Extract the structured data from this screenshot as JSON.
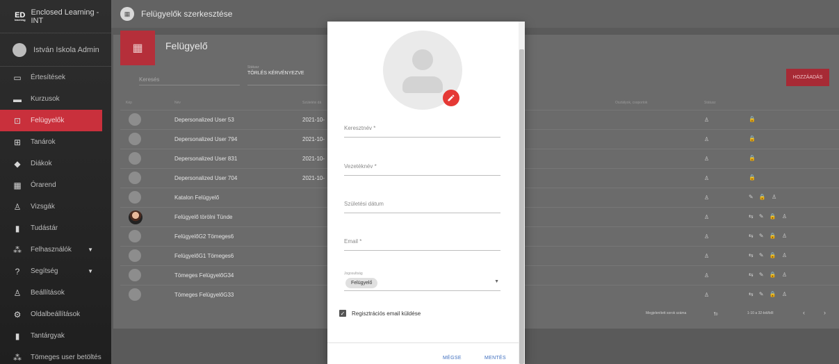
{
  "app": {
    "brand": "Enclosed Learning - INT",
    "logo": "ED",
    "logo_sub": "learning"
  },
  "user": {
    "name": "István Iskola Admin"
  },
  "sidebar": {
    "items": [
      {
        "label": "Értesítések",
        "icon": "message-icon",
        "glyph": "▭"
      },
      {
        "label": "Kurzusok",
        "icon": "course-icon",
        "glyph": "▬"
      },
      {
        "label": "Felügyelők",
        "icon": "monitor-person-icon",
        "glyph": "⊡",
        "active": true
      },
      {
        "label": "Tanárok",
        "icon": "teacher-icon",
        "glyph": "⊞"
      },
      {
        "label": "Diákok",
        "icon": "school-icon",
        "glyph": "◆"
      },
      {
        "label": "Órarend",
        "icon": "calendar-icon",
        "glyph": "▦"
      },
      {
        "label": "Vizsgák",
        "icon": "exam-icon",
        "glyph": "♙"
      },
      {
        "label": "Tudástár",
        "icon": "library-icon",
        "glyph": "▮"
      },
      {
        "label": "Felhasználók",
        "icon": "users-icon",
        "glyph": "⁂",
        "chevron": true
      },
      {
        "label": "Segítség",
        "icon": "help-icon",
        "glyph": "?",
        "chevron": true
      },
      {
        "label": "Beállítások",
        "icon": "settings-person-icon",
        "glyph": "♙"
      },
      {
        "label": "Oldalbeállítások",
        "icon": "site-settings-icon",
        "glyph": "⚙"
      },
      {
        "label": "Tantárgyak",
        "icon": "subjects-icon",
        "glyph": "▮"
      },
      {
        "label": "Tömeges user betöltés",
        "icon": "bulk-upload-icon",
        "glyph": "⁂"
      }
    ]
  },
  "topbar": {
    "title": "Felügyelők szerkesztése"
  },
  "page": {
    "title": "Felügyelő",
    "search_placeholder": "Keresés",
    "status_label": "Státusz",
    "status_value": "TÖRLÉS KÉRVÉNYEZVE",
    "add_button": "HOZZÁADÁS",
    "columns": [
      "Kép",
      "Név",
      "Születési dá",
      "Osztályok, csoportok",
      "Státusz"
    ],
    "rows": [
      {
        "name": "Depersonalized User 53",
        "dob": "2021-10-",
        "status": "♙",
        "actions": "🔒"
      },
      {
        "name": "Depersonalized User 794",
        "dob": "2021-10-",
        "status": "♙",
        "actions": "🔒"
      },
      {
        "name": "Depersonalized User 831",
        "dob": "2021-10-",
        "status": "♙",
        "actions": "🔒"
      },
      {
        "name": "Depersonalized User 704",
        "dob": "2021-10-",
        "status": "♙",
        "actions": "🔒"
      },
      {
        "name": "Katalon Felügyelő",
        "dob": "",
        "status": "♙",
        "actions": "✎ 🔒 ♙"
      },
      {
        "name": "Felügyelő törölni Tünde",
        "dob": "",
        "status": "♙",
        "actions": "⇆ ✎ 🔒 ♙",
        "photo": true
      },
      {
        "name": "FelügyelőG2 Tömeges6",
        "dob": "",
        "status": "♙",
        "actions": "⇆ ✎ 🔒 ♙"
      },
      {
        "name": "FelügyelőG1 Tömeges6",
        "dob": "",
        "status": "♙",
        "actions": "⇆ ✎ 🔒 ♙"
      },
      {
        "name": "Tömeges FelügyelőG34",
        "dob": "",
        "status": "♙",
        "actions": "⇆ ✎ 🔒 ♙"
      },
      {
        "name": "Tömeges FelügyelőG33",
        "dob": "",
        "status": "♙",
        "actions": "⇆ ✎ 🔒 ♙"
      }
    ],
    "footer": {
      "rows_label": "Megjelenített sorok száma",
      "rows_value": "10",
      "range": "1-10 a 32-ból/ből",
      "prev": "‹",
      "next": "›"
    }
  },
  "modal": {
    "first_name_label": "Keresztnév *",
    "last_name_label": "Vezetéknév *",
    "dob_label": "Születési dátum",
    "email_label": "Email *",
    "role_label": "Jogosultság",
    "role_value": "Felügyelő",
    "send_email_label": "Regisztrációs email küldése",
    "send_email_checked": true,
    "cancel": "MÉGSE",
    "save": "MENTÉS"
  },
  "colors": {
    "accent": "#c9303c",
    "link": "#3f6fbf",
    "fab": "#e53935"
  }
}
